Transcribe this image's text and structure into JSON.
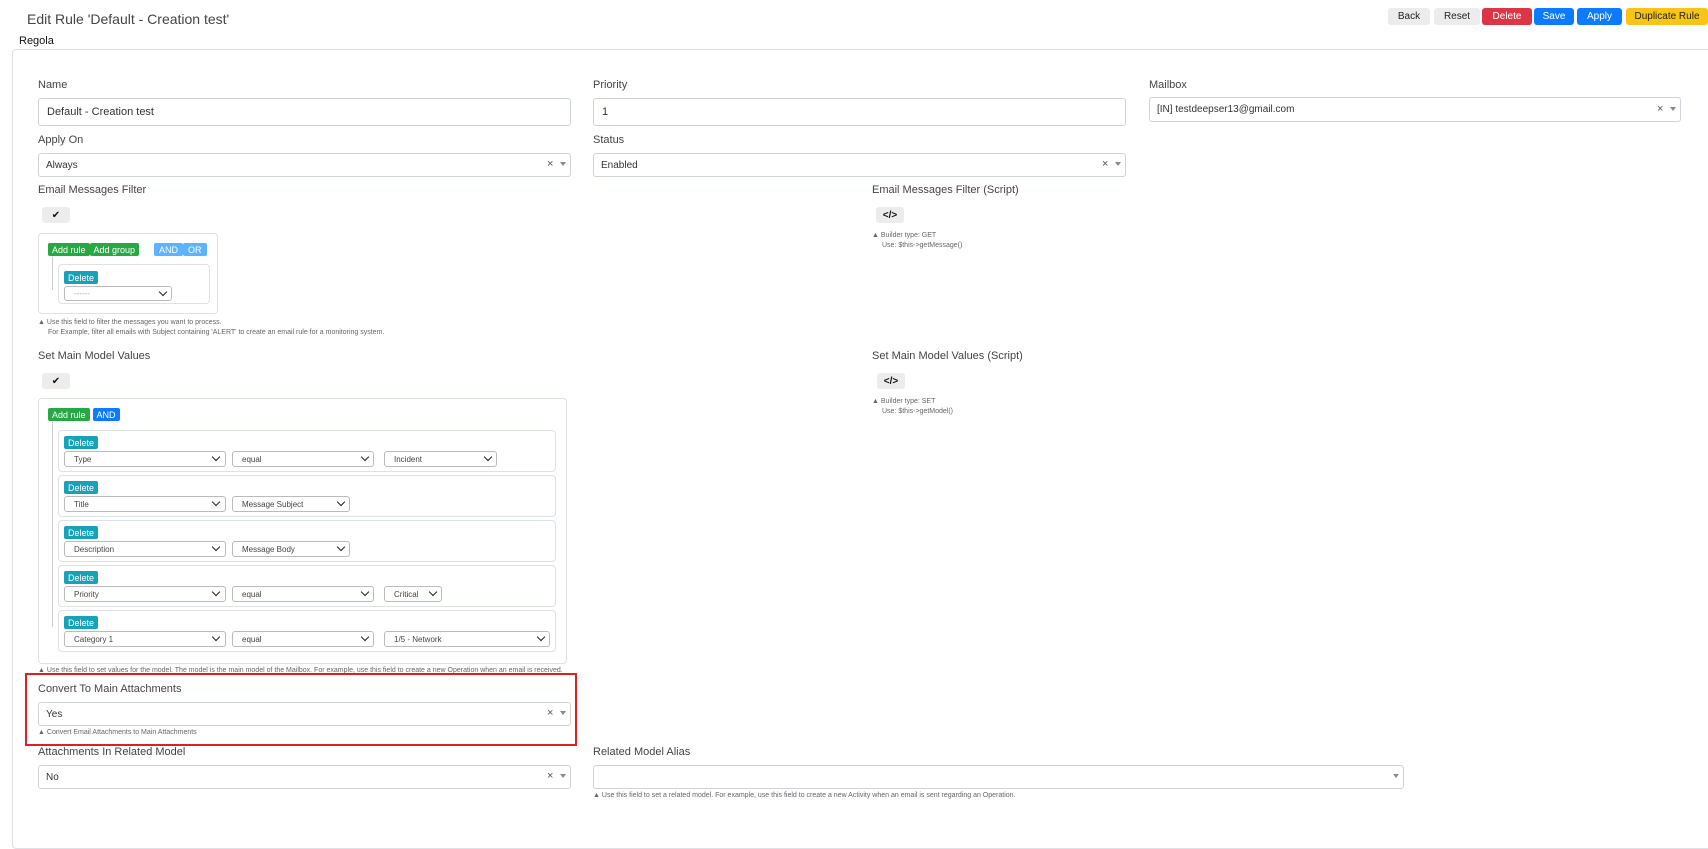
{
  "header": {
    "title": "Edit Rule 'Default - Creation test'",
    "tab": "Regola",
    "buttons": {
      "back": "Back",
      "reset": "Reset",
      "delete": "Delete",
      "save": "Save",
      "apply": "Apply",
      "duplicate": "Duplicate Rule"
    }
  },
  "form": {
    "name": {
      "label": "Name",
      "value": "Default - Creation test"
    },
    "priority": {
      "label": "Priority",
      "value": "1"
    },
    "mailbox": {
      "label": "Mailbox",
      "value": "[IN] testdeepser13@gmail.com"
    },
    "apply_on": {
      "label": "Apply On",
      "value": "Always"
    },
    "status": {
      "label": "Status",
      "value": "Enabled"
    },
    "email_filter": {
      "label": "Email Messages Filter",
      "add_rule": "Add rule",
      "add_group": "Add group",
      "and": "AND",
      "or": "OR",
      "delete": "Delete",
      "select_value": "------",
      "help_line1": "Use this field to filter the messages you want to process.",
      "help_line2": "For Example, filter all emails with Subject containing 'ALERT' to create an email rule for a monitoring system."
    },
    "email_filter_script": {
      "label": "Email Messages Filter (Script)",
      "help_line1": "Builder type: GET",
      "help_line2": "Use: $this->getMessage()"
    },
    "main_model": {
      "label": "Set Main Model Values",
      "add_rule": "Add rule",
      "and": "AND",
      "delete": "Delete",
      "rules": [
        {
          "field": "Type",
          "operator": "equal",
          "value": "Incident"
        },
        {
          "field": "Title",
          "operator": "Message Subject",
          "value": ""
        },
        {
          "field": "Description",
          "operator": "Message Body",
          "value": ""
        },
        {
          "field": "Priority",
          "operator": "equal",
          "value": "Critical"
        },
        {
          "field": "Category 1",
          "operator": "equal",
          "value": "1/5 - Network"
        }
      ],
      "help": "Use this field to set values for the model. The model is the main model of the Mailbox. For example, use this field to create a new Operation when an email is received."
    },
    "main_model_script": {
      "label": "Set Main Model Values (Script)",
      "help_line1": "Builder type: SET",
      "help_line2": "Use: $this->getModel()"
    },
    "convert_attachments": {
      "label": "Convert To Main Attachments",
      "value": "Yes",
      "help": "Convert Email Attachments to Main Attachments"
    },
    "attachments_related": {
      "label": "Attachments In Related Model",
      "value": "No"
    },
    "related_alias": {
      "label": "Related Model Alias",
      "value": "",
      "help": "Use this field to set a related model. For example, use this field to create a new Activity when an email is sent regarding an Operation."
    }
  },
  "icons": {
    "builder": "double-check-icon",
    "script": "code-icon",
    "help": "triangle-up-icon"
  },
  "colors": {
    "danger": "#dc3545",
    "primary": "#0d7bff",
    "warning": "#f7c518",
    "success": "#28a745",
    "info": "#17a2b8",
    "highlight": "#e02020"
  }
}
